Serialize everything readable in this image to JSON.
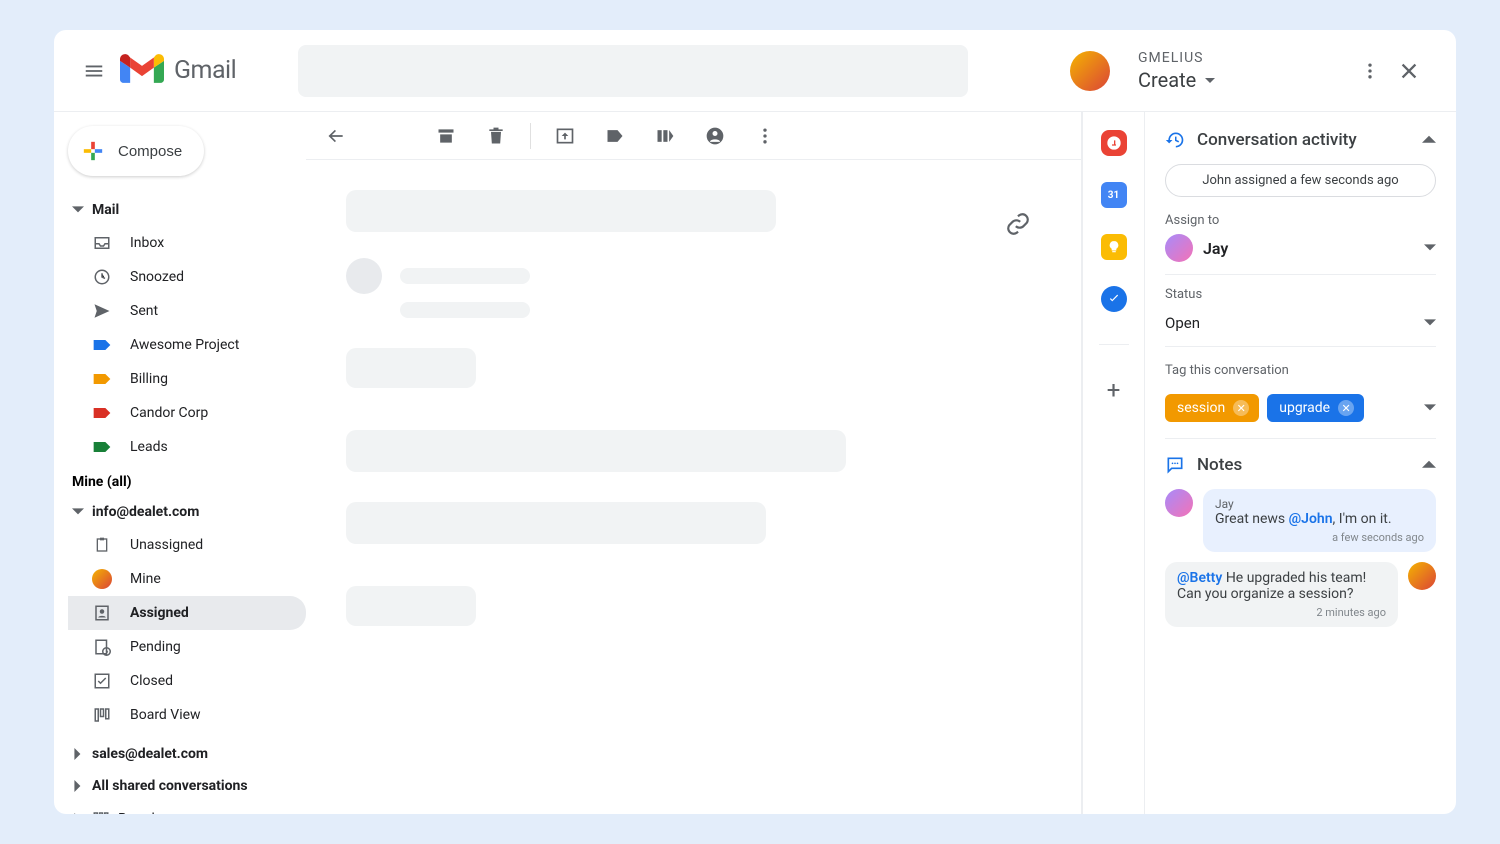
{
  "header": {
    "app_name": "Gmail"
  },
  "gmelius_header": {
    "brand": "GMELIUS",
    "action": "Create"
  },
  "sidebar": {
    "compose": "Compose",
    "mail_label": "Mail",
    "items": {
      "inbox": "Inbox",
      "snoozed": "Snoozed",
      "sent": "Sent",
      "awesome": "Awesome Project",
      "billing": "Billing",
      "candor": "Candor Corp",
      "leads": "Leads"
    },
    "mine_all": "Mine (all)",
    "info_mailbox": "info@dealet.com",
    "mailbox_items": {
      "unassigned": "Unassigned",
      "mine": "Mine",
      "assigned": "Assigned",
      "pending": "Pending",
      "closed": "Closed",
      "board": "Board View"
    },
    "sales_mailbox": "sales@dealet.com",
    "all_shared": "All shared conversations",
    "boards": "Boards"
  },
  "activity": {
    "title": "Conversation activity",
    "event": "John assigned a few seconds ago",
    "assign_label": "Assign to",
    "assignee": "Jay",
    "status_label": "Status",
    "status": "Open",
    "tag_label": "Tag this conversation",
    "tags": {
      "session": "session",
      "upgrade": "upgrade"
    }
  },
  "notes": {
    "title": "Notes",
    "items": [
      {
        "from": "Jay",
        "mention": "@John",
        "pre": "Great news ",
        "post": ", I'm on it.",
        "time": "a few seconds ago"
      },
      {
        "mention": "@Betty",
        "post": " He upgraded his team! Can you organize a session?",
        "time": "2 minutes ago"
      }
    ]
  }
}
